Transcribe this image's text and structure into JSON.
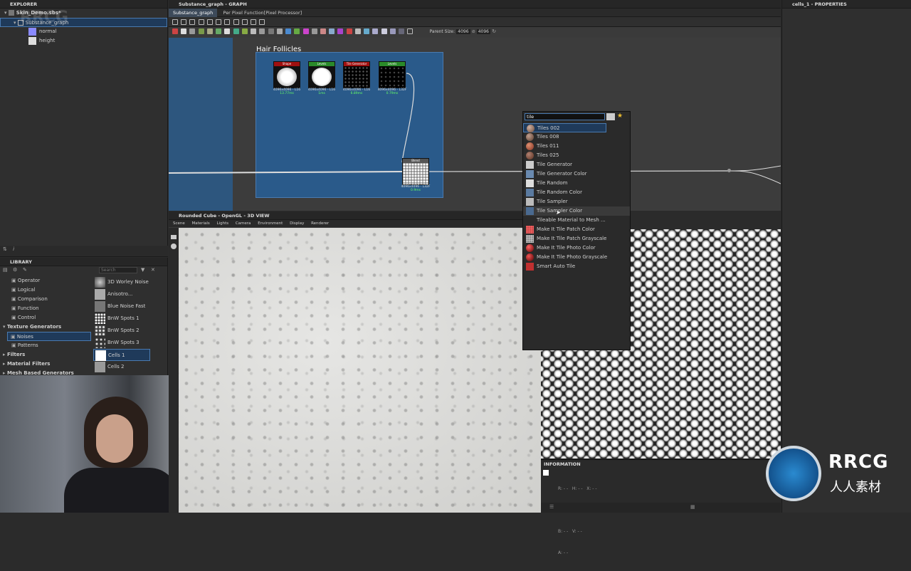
{
  "watermark_top_left": "RRCG",
  "explorer": {
    "title": "EXPLORER",
    "file": "Skin_Demo.sbs*",
    "graph": "Substance_graph",
    "outputs": [
      {
        "label": "normal",
        "color": "#8a8aff"
      },
      {
        "label": "height",
        "color": "#dddddd"
      }
    ]
  },
  "graph": {
    "panel_title": "Substance_graph - GRAPH",
    "tabs": [
      "Substance_graph",
      "Per Pixel Function[Pixel Processor]"
    ],
    "parent_size_label": "Parent Size:",
    "parent_size_value": "4096",
    "size_value": "4096",
    "frame_title": "Hair Follicles",
    "nodes": [
      {
        "header": "Shape",
        "color": "#a01010",
        "size": "4096x4096 - L16",
        "time": "13.77ms"
      },
      {
        "header": "Levels",
        "color": "#2a8a2a",
        "size": "4096x4096 - L16",
        "time": "1ms"
      },
      {
        "header": "Tile Generator",
        "color": "#a01010",
        "size": "4096x4096 - L16",
        "time": "6.89ms"
      },
      {
        "header": "Levels",
        "color": "#2a8a2a",
        "size": "4096x4096 - L32F",
        "time": "0.79ms"
      },
      {
        "header": "Blend",
        "color": "#888888",
        "size": "4096x4096 - L32F",
        "time": "0.9ms"
      }
    ]
  },
  "popup": {
    "search_value": "tile",
    "items": [
      {
        "label": "Tiles 002",
        "color": "#9a7a6a"
      },
      {
        "label": "Tiles 008",
        "color": "#8a6a5a"
      },
      {
        "label": "Tiles 011",
        "color": "#b06040"
      },
      {
        "label": "Tiles 025",
        "color": "#8a5a4a"
      },
      {
        "label": "Tile Generator",
        "color": "#cccccc"
      },
      {
        "label": "Tile Generator Color",
        "color": "#6a8ab0"
      },
      {
        "label": "Tile Random",
        "color": "#dddddd"
      },
      {
        "label": "Tile Random Color",
        "color": "#5a7aa0"
      },
      {
        "label": "Tile Sampler",
        "color": "#bbbbbb"
      },
      {
        "label": "Tile Sampler Color",
        "color": "#4a6a90"
      },
      {
        "label": "Tileable Material to Mesh ...",
        "color": "#2a2a2a"
      },
      {
        "label": "Make It Tile Patch Color",
        "color": "#a03030"
      },
      {
        "label": "Make It Tile Patch Grayscale",
        "color": "#888888"
      },
      {
        "label": "Make It Tile Photo Color",
        "color": "#b02020"
      },
      {
        "label": "Make It Tile Photo Grayscale",
        "color": "#a02020"
      },
      {
        "label": "Smart Auto Tile",
        "color": "#c03030"
      }
    ]
  },
  "properties": {
    "title": "cells_1 - PROPERTIES"
  },
  "library": {
    "title": "LIBRARY",
    "search_placeholder": "Search",
    "categories": [
      {
        "label": "Operator",
        "bold": false,
        "indent": 1
      },
      {
        "label": "Logical",
        "bold": false,
        "indent": 1
      },
      {
        "label": "Comparison",
        "bold": false,
        "indent": 1
      },
      {
        "label": "Function",
        "bold": false,
        "indent": 1
      },
      {
        "label": "Control",
        "bold": false,
        "indent": 1
      },
      {
        "label": "Texture Generators",
        "bold": true,
        "indent": 0
      },
      {
        "label": "Noises",
        "bold": false,
        "indent": 1
      },
      {
        "label": "Patterns",
        "bold": false,
        "indent": 1
      },
      {
        "label": "Filters",
        "bold": true,
        "indent": 0
      },
      {
        "label": "Material Filters",
        "bold": true,
        "indent": 0
      },
      {
        "label": "Mesh Based Generators",
        "bold": true,
        "indent": 0
      }
    ],
    "items": [
      "3D Worley Noise",
      "Anisotro...",
      "Blue Noise Fast",
      "BnW Spots 1",
      "BnW Spots 2",
      "BnW Spots 3",
      "Cells 1",
      "Cells 2"
    ]
  },
  "view3d": {
    "title": "Rounded Cube - OpenGL - 3D VIEW",
    "menu": [
      "Scene",
      "Materials",
      "Lights",
      "Camera",
      "Environment",
      "Display",
      "Renderer"
    ]
  },
  "info": {
    "title": "INFORMATION",
    "rows": [
      "R: - -   H: - -   X: - -",
      "G: - -   S: - -   Y: - -",
      "B: - -   V: - -",
      "A: - -"
    ]
  },
  "brand": {
    "logo": "RRCG",
    "sub": "人人素材"
  }
}
